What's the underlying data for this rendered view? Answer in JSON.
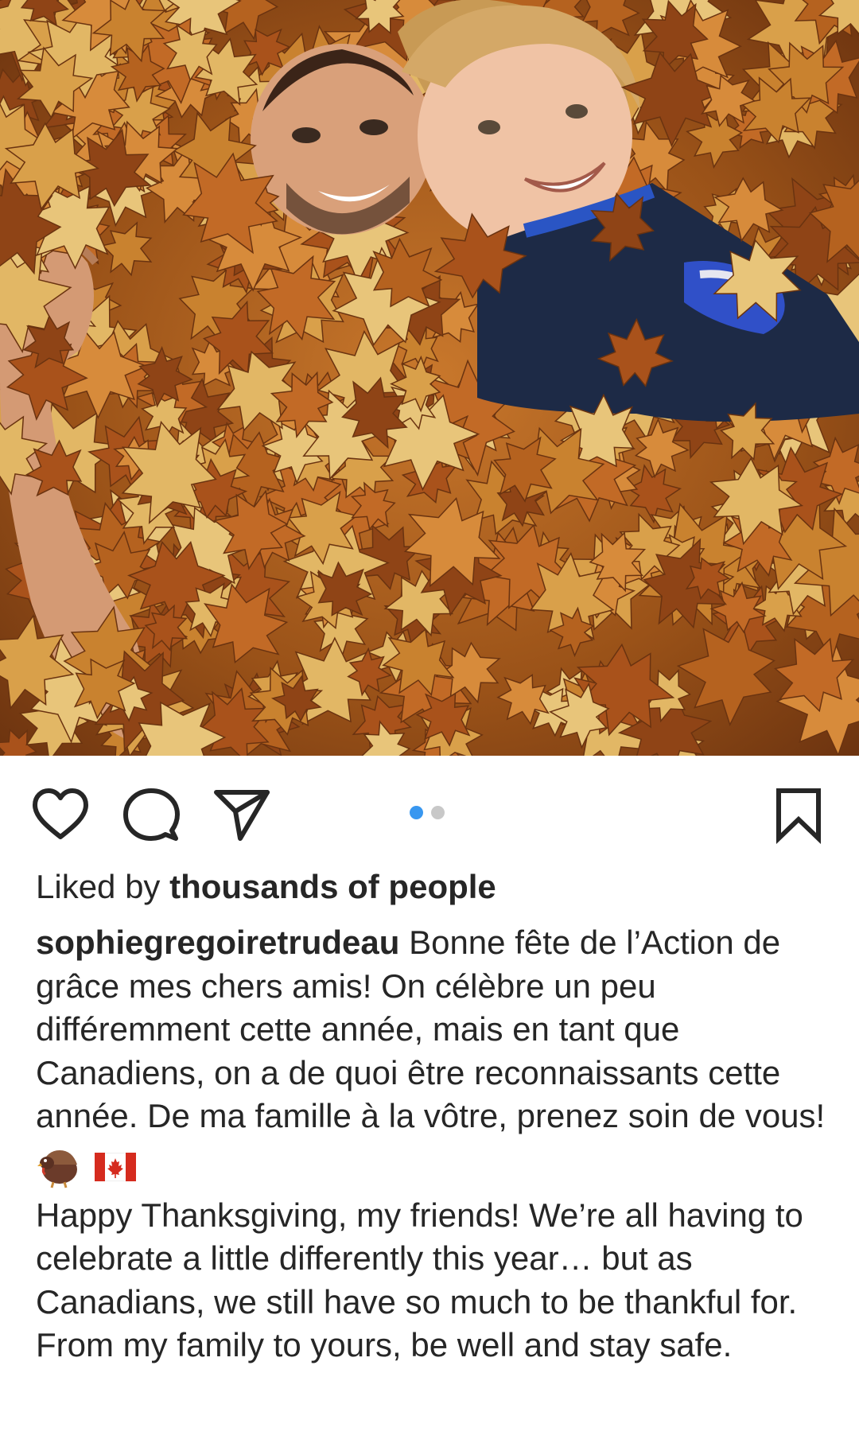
{
  "post": {
    "likes_prefix": "Liked by ",
    "likes_strong": "thousands of people",
    "username": "sophiegregoiretrudeau",
    "caption_fr": "Bonne fête de l’Action de grâce mes chers amis! On célèbre un peu différemment cette année, mais en tant que Canadiens, on a de quoi être reconnaissants cette année. De ma famille à la vôtre, prenez soin de vous!",
    "emojis": [
      "turkey-icon",
      "canada-flag-icon"
    ],
    "caption_en": "Happy Thanksgiving, my friends! We’re all having to celebrate a little differently this year… but as Canadians, we still have so much to be thankful for. From my family to yours, be well and stay safe."
  },
  "carousel": {
    "total": 2,
    "current": 1
  },
  "icons": {
    "like": "heart-icon",
    "comment": "comment-bubble-icon",
    "share": "paper-plane-icon",
    "save": "bookmark-icon"
  },
  "colors": {
    "text": "#262626",
    "dot_active": "#3897f0",
    "dot_inactive": "#c8c8c8"
  }
}
